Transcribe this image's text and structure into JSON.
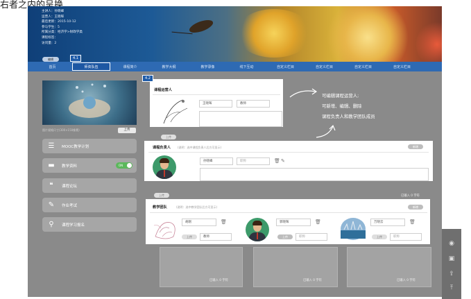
{
  "caption": "右者之内的呈换",
  "course_info": {
    "lines": [
      "主讲人：孙晓峰",
      "运营人：王晓晖",
      "最后更新：2015-10-12",
      "参与学生：5",
      "所属分类：经济学>财政学类",
      "课程标签：",
      "访问量：2"
    ],
    "edit_label": "编辑"
  },
  "tags": {
    "t41": "4.1",
    "t42": "4.2"
  },
  "nav": {
    "tabs": [
      "首页",
      "师资队伍",
      "课程简介",
      "教学大纲",
      "教学录像",
      "线下互动",
      "自定义栏目",
      "自定义栏目",
      "自定义栏目",
      "自定义栏目"
    ],
    "active_index": 1
  },
  "sidebar": {
    "thumb_caption": "图片规格尺寸(300×150像素)",
    "upload_label": "上传",
    "items": [
      {
        "icon": "list-icon",
        "label": "MOOC教学计划"
      },
      {
        "icon": "folder-icon",
        "label": "教学资料",
        "toggle": "ON"
      },
      {
        "icon": "chat-icon",
        "label": "课程论坛"
      },
      {
        "icon": "pencil-icon",
        "label": "作业考试"
      },
      {
        "icon": "location-pin-icon",
        "label": "课程学习报名"
      }
    ]
  },
  "operator_panel": {
    "title": "课程运营人",
    "name_value": "王晓晖",
    "title_value": "教师",
    "upload_label": "上传"
  },
  "owner_panel": {
    "title": "课程负责人",
    "hint": "(说明：选中课程负责人后方可显示)",
    "add_label": "新增",
    "name_value": "孙晓峰",
    "title_placeholder": "职称",
    "count_label": "已输入 0 字符",
    "upload_label": "上传"
  },
  "team_panel": {
    "title": "教学团队",
    "hint": "(说明：选中教学团队后方可显示)",
    "add_label": "新增",
    "members": [
      {
        "name": "胡刚",
        "title_value": "教师",
        "upload_label": "上传"
      },
      {
        "name": "郭晓晖",
        "title_value": "职称",
        "upload_label": "上传"
      },
      {
        "name": "万晓云",
        "title_value": "职称",
        "upload_label": "上传"
      }
    ],
    "count_labels": [
      "已输入 0 字符",
      "已输入 0 字符",
      "已输入 0 字符"
    ]
  },
  "annotation": {
    "lines": [
      "可编辑课程运营人;",
      "可新增、编辑、删除",
      "课程负责人和教学团队成员"
    ]
  },
  "right_tools": [
    "eye-icon",
    "save-icon",
    "share-icon",
    "to-top-icon"
  ],
  "colors": {
    "nav_bg": "#2e6ab3",
    "nav_active": "#1d57a3",
    "body_grey": "#8a8a8a",
    "toggle_green": "#5cb85c",
    "avatar_green": "#3d9a6a"
  }
}
